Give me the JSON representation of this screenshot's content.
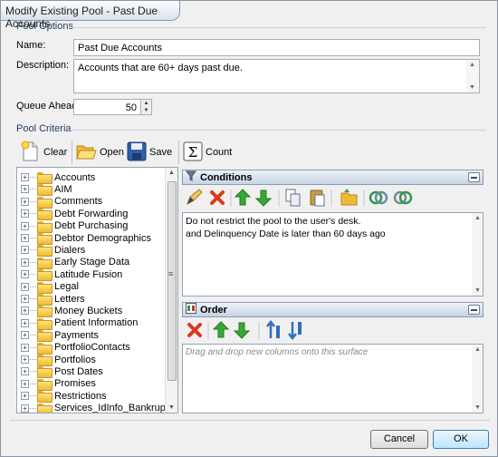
{
  "window": {
    "title": "Modify Existing Pool - Past Due Accounts"
  },
  "pool_options": {
    "group_title": "Pool Options",
    "name_label": "Name:",
    "name_value": "Past Due Accounts",
    "description_label": "Description:",
    "description_value": "Accounts that are 60+ days past due.",
    "queue_ahead_label": "Queue Ahead:",
    "queue_ahead_value": "50"
  },
  "pool_criteria": {
    "group_title": "Pool Criteria",
    "toolbar": {
      "clear_label": "Clear",
      "open_label": "Open",
      "save_label": "Save",
      "count_label": "Count"
    },
    "tree_items": [
      "Accounts",
      "AIM",
      "Comments",
      "Debt Forwarding",
      "Debt Purchasing",
      "Debtor Demographics",
      "Dialers",
      "Early Stage Data",
      "Latitude Fusion",
      "Legal",
      "Letters",
      "Money Buckets",
      "Patient Information",
      "Payments",
      "PortfolioContacts",
      "Portfolios",
      "Post Dates",
      "Promises",
      "Restrictions",
      "Services_IdInfo_Bankruptcy"
    ]
  },
  "conditions": {
    "title": "Conditions",
    "lines": [
      "Do not restrict the pool to the user's desk.",
      "and Delinquency Date is later than 60 days ago"
    ]
  },
  "order": {
    "title": "Order",
    "placeholder": "Drag and drop new columns onto this surface"
  },
  "footer": {
    "cancel_label": "Cancel",
    "ok_label": "OK"
  },
  "colors": {
    "accent": "#1e395b",
    "folder": "#f0bb34",
    "delete": "#d83a1e",
    "arrow": "#38a838"
  }
}
